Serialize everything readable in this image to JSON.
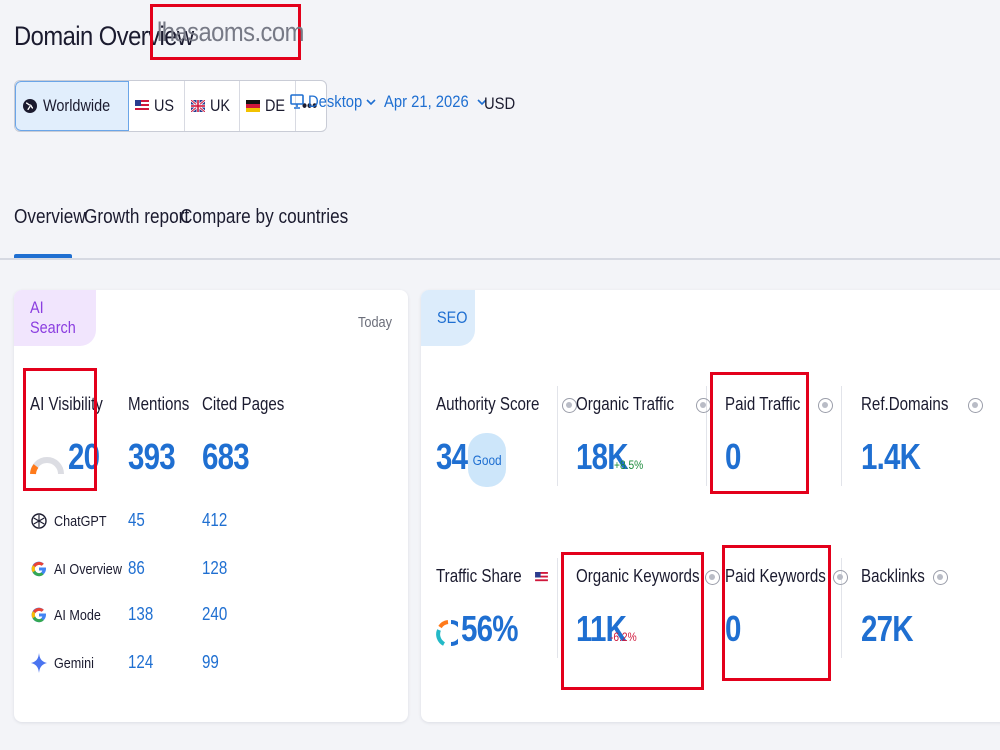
{
  "header": {
    "title": "Domain Overview",
    "domain": "lhasaoms.com"
  },
  "filters": {
    "databases": [
      {
        "label": "Worldwide",
        "icon": "globe-icon"
      },
      {
        "label": "US",
        "icon": "us-flag-icon"
      },
      {
        "label": "UK",
        "icon": "uk-flag-icon"
      },
      {
        "label": "DE",
        "icon": "de-flag-icon"
      },
      {
        "label": "•••",
        "icon": "more-icon"
      }
    ],
    "device": "Desktop",
    "date": "Apr 21, 2026",
    "currency": "USD"
  },
  "tabs": [
    {
      "label": "Overview",
      "active": true
    },
    {
      "label": "Growth report",
      "active": false
    },
    {
      "label": "Compare by countries",
      "active": false
    }
  ],
  "ai_search": {
    "badge": "AI Search",
    "period": "Today",
    "visibility_label": "AI Visibility",
    "visibility_value": "20",
    "mentions_label": "Mentions",
    "mentions_value": "393",
    "cited_label": "Cited Pages",
    "cited_value": "683",
    "sources": [
      {
        "name": "ChatGPT",
        "mentions": "45",
        "cited": "412",
        "icon": "chatgpt-icon"
      },
      {
        "name": "AI Overview",
        "mentions": "86",
        "cited": "128",
        "icon": "google-icon"
      },
      {
        "name": "AI Mode",
        "mentions": "138",
        "cited": "240",
        "icon": "google-icon"
      },
      {
        "name": "Gemini",
        "mentions": "124",
        "cited": "99",
        "icon": "gemini-icon"
      }
    ]
  },
  "seo": {
    "badge": "SEO",
    "authority_label": "Authority Score",
    "authority_value": "34",
    "authority_rating": "Good",
    "organic_traffic_label": "Organic Traffic",
    "organic_traffic_value": "18K",
    "organic_traffic_delta": "+8.5%",
    "paid_traffic_label": "Paid Traffic",
    "paid_traffic_value": "0",
    "ref_domains_label": "Ref.Domains",
    "ref_domains_value": "1.4K",
    "traffic_share_label": "Traffic Share",
    "traffic_share_value": "56%",
    "organic_keywords_label": "Organic Keywords",
    "organic_keywords_value": "11K",
    "organic_keywords_delta": "-6.2%",
    "paid_keywords_label": "Paid Keywords",
    "paid_keywords_value": "0",
    "backlinks_label": "Backlinks",
    "backlinks_value": "27K"
  },
  "colors": {
    "accent": "#1f6fd1",
    "highlight": "#e3001b",
    "ai_badge": "#8b3ee0",
    "positive": "#1b8a3a",
    "negative": "#d0173b"
  }
}
